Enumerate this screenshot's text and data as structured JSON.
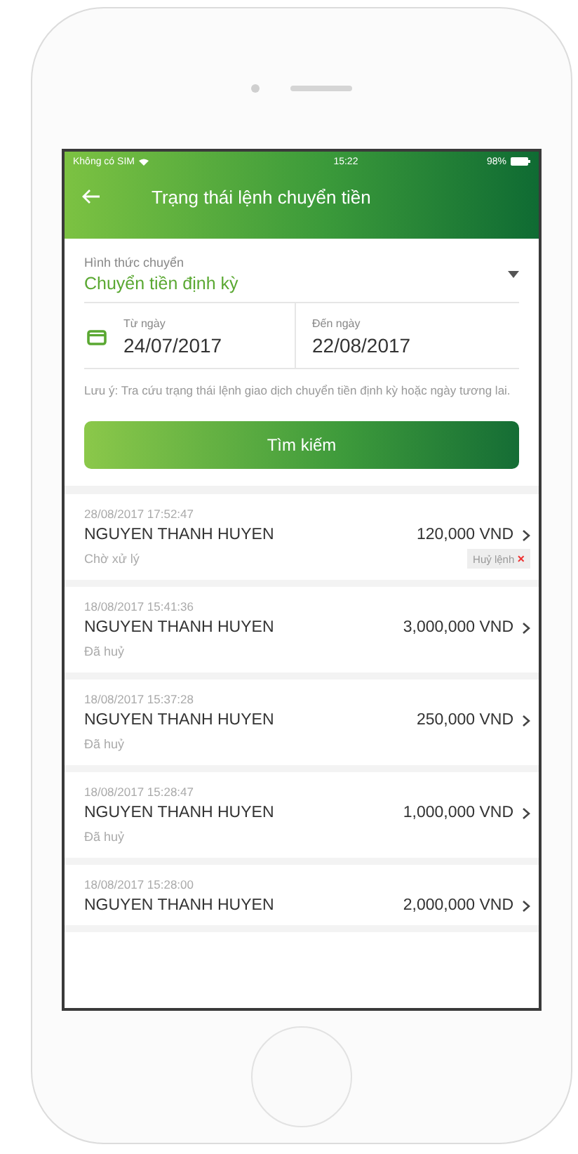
{
  "status_bar": {
    "carrier": "Không có SIM",
    "time": "15:22",
    "battery": "98%"
  },
  "header": {
    "title": "Trạng thái lệnh chuyển tiền"
  },
  "form": {
    "transfer_type": {
      "label": "Hình thức chuyển",
      "value": "Chuyển tiền định kỳ"
    },
    "from_date": {
      "label": "Từ ngày",
      "value": "24/07/2017"
    },
    "to_date": {
      "label": "Đến ngày",
      "value": "22/08/2017"
    },
    "note": "Lưu ý: Tra cứu trạng thái lệnh giao dịch chuyển tiền định kỳ hoặc ngày tương lai.",
    "search_button": "Tìm kiếm"
  },
  "transactions": [
    {
      "datetime": "28/08/2017 17:52:47",
      "name": "NGUYEN THANH HUYEN",
      "amount": "120,000 VND",
      "status": "Chờ xử lý",
      "action": {
        "label": "Huỷ lệnh",
        "icon": "×"
      }
    },
    {
      "datetime": "18/08/2017 15:41:36",
      "name": "NGUYEN THANH HUYEN",
      "amount": "3,000,000 VND",
      "status": "Đã huỷ"
    },
    {
      "datetime": "18/08/2017 15:37:28",
      "name": "NGUYEN THANH HUYEN",
      "amount": "250,000 VND",
      "status": "Đã huỷ"
    },
    {
      "datetime": "18/08/2017 15:28:47",
      "name": "NGUYEN THANH HUYEN",
      "amount": "1,000,000 VND",
      "status": "Đã huỷ"
    },
    {
      "datetime": "18/08/2017 15:28:00",
      "name": "NGUYEN THANH HUYEN",
      "amount": "2,000,000 VND"
    }
  ]
}
